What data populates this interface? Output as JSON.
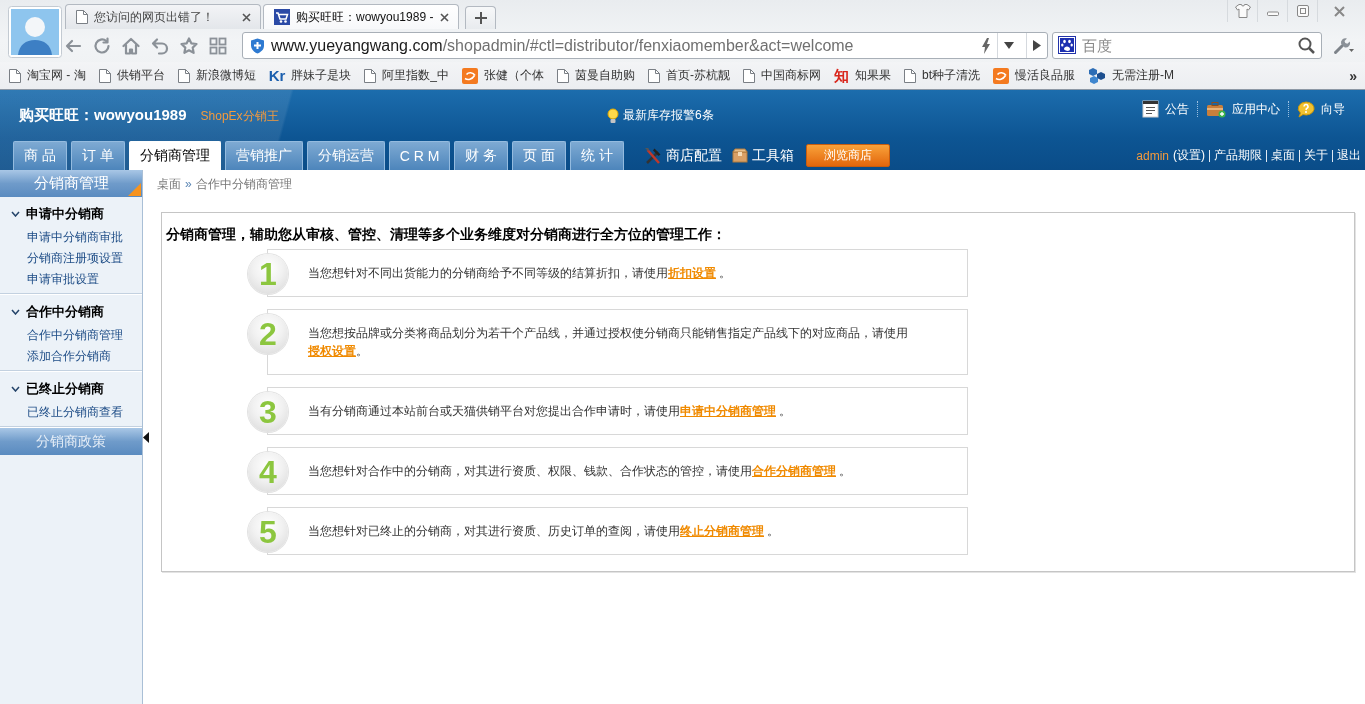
{
  "browser": {
    "tabs": [
      {
        "title": "您访问的网页出错了！",
        "kind": "page",
        "selected": false
      },
      {
        "title": "购买旺旺：wowyou1989 -",
        "kind": "cart",
        "selected": true
      }
    ],
    "address": {
      "host": "www.yueyangwang.com",
      "path": "/shopadmin/#ctl=distributor/fenxiaomember&act=welcome"
    },
    "search": {
      "placeholder": "百度"
    },
    "bookmarks": [
      {
        "label": "淘宝网 - 淘",
        "kind": "page"
      },
      {
        "label": "供销平台",
        "kind": "page"
      },
      {
        "label": "新浪微博短",
        "kind": "page"
      },
      {
        "label": "胖妹子是块",
        "kind": "letters",
        "badge": "Kr",
        "color": "#1b5fae"
      },
      {
        "label": "阿里指数_中",
        "kind": "page"
      },
      {
        "label": "张健（个体",
        "kind": "tile"
      },
      {
        "label": "茵曼自助购",
        "kind": "page"
      },
      {
        "label": "首页-苏杭靓",
        "kind": "page"
      },
      {
        "label": "中国商标网",
        "kind": "page"
      },
      {
        "label": "知果果",
        "kind": "letters",
        "badge": "知",
        "color": "#d9261c"
      },
      {
        "label": "bt种子清洗",
        "kind": "page"
      },
      {
        "label": "慢活良品服",
        "kind": "tile"
      },
      {
        "label": "无需注册-M",
        "kind": "cubes"
      }
    ],
    "bookmarks_more": "»"
  },
  "app": {
    "title": "购买旺旺：wowyou1989",
    "brand": "ShopEx分销王",
    "alert": "最新库存报警6条",
    "top_links": [
      {
        "label": "公告",
        "kind": "notice"
      },
      {
        "label": "应用中心",
        "kind": "apps"
      },
      {
        "label": "向导",
        "kind": "help"
      }
    ],
    "nav_tabs": [
      {
        "label": "商 品",
        "selected": false
      },
      {
        "label": "订 单",
        "selected": false
      },
      {
        "label": "分销商管理",
        "selected": true
      },
      {
        "label": "营销推广",
        "selected": false
      },
      {
        "label": "分销运营",
        "selected": false
      },
      {
        "label": "C R M",
        "selected": false
      },
      {
        "label": "财 务",
        "selected": false
      },
      {
        "label": "页 面",
        "selected": false
      },
      {
        "label": "统 计",
        "selected": false
      }
    ],
    "tools": [
      {
        "label": "商店配置",
        "kind": "tools"
      },
      {
        "label": "工具箱",
        "kind": "box"
      }
    ],
    "browse_button": "浏览商店",
    "user": "admin",
    "user_links": [
      "(设置)",
      "产品期限",
      "桌面",
      "关于",
      "退出"
    ]
  },
  "sidebar": {
    "sections": [
      {
        "title": "分销商管理",
        "selected": true,
        "groups": [
          {
            "title": "申请中分销商",
            "expanded": true,
            "items": [
              "申请中分销商审批",
              "分销商注册项设置",
              "申请审批设置"
            ]
          },
          {
            "title": "合作中分销商",
            "expanded": true,
            "items": [
              "合作中分销商管理",
              "添加合作分销商"
            ]
          },
          {
            "title": "已终止分销商",
            "expanded": true,
            "items": [
              "已终止分销商查看"
            ]
          }
        ]
      },
      {
        "title": "分销商政策",
        "selected": false
      }
    ]
  },
  "breadcrumb": {
    "items": [
      "桌面",
      "合作中分销商管理"
    ],
    "separator": "»"
  },
  "welcome": {
    "title": "分销商管理，辅助您从审核、管控、清理等多个业务维度对分销商进行全方位的管理工作：",
    "steps": [
      {
        "number": "1",
        "text": "当您想针对不同出货能力的分销商给予不同等级的结算折扣，请使用",
        "link": "折扣设置",
        "after": " 。"
      },
      {
        "number": "2",
        "text": "当您想按品牌或分类将商品划分为若干个产品线，并通过授权使分销商只能销售指定产品线下的对应商品，请使用",
        "link": "授权设置",
        "after": "。"
      },
      {
        "number": "3",
        "text": "当有分销商通过本站前台或天猫供销平台对您提出合作申请时，请使用",
        "link": "申请中分销商管理",
        "after": " 。"
      },
      {
        "number": "4",
        "text": "当您想针对合作中的分销商，对其进行资质、权限、钱款、合作状态的管控，请使用",
        "link": "合作分销商管理",
        "after": " 。"
      },
      {
        "number": "5",
        "text": "当您想针对已终止的分销商，对其进行资质、历史订单的查阅，请使用",
        "link": "终止分销商管理",
        "after": " 。"
      }
    ]
  }
}
